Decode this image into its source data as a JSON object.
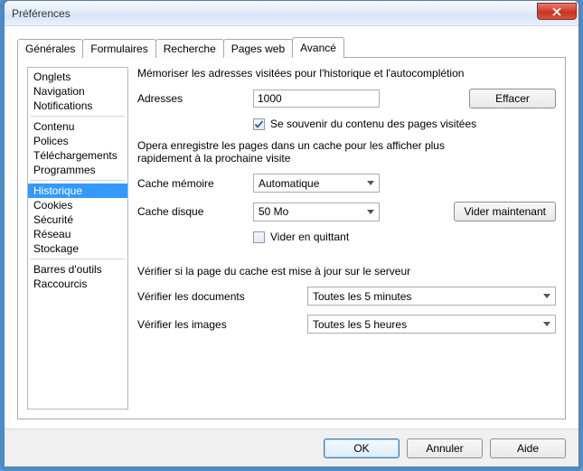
{
  "window": {
    "title": "Préférences"
  },
  "tabs": [
    {
      "label": "Générales"
    },
    {
      "label": "Formulaires"
    },
    {
      "label": "Recherche"
    },
    {
      "label": "Pages web"
    },
    {
      "label": "Avancé"
    }
  ],
  "sidebar": {
    "groups": [
      [
        "Onglets",
        "Navigation",
        "Notifications"
      ],
      [
        "Contenu",
        "Polices",
        "Téléchargements",
        "Programmes"
      ],
      [
        "Historique",
        "Cookies",
        "Sécurité",
        "Réseau",
        "Stockage"
      ],
      [
        "Barres d'outils",
        "Raccourcis"
      ]
    ],
    "selected": "Historique"
  },
  "history": {
    "intro": "Mémoriser les adresses visitées pour l'historique et l'autocomplétion",
    "addresses_label": "Adresses",
    "addresses_value": "1000",
    "clear_label": "Effacer",
    "remember_content_checked": true,
    "remember_content_label": "Se souvenir du contenu des pages visitées",
    "cache_intro": "Opera enregistre les pages dans un cache pour les afficher plus rapidement à la prochaine visite",
    "mem_cache_label": "Cache mémoire",
    "mem_cache_value": "Automatique",
    "disk_cache_label": "Cache disque",
    "disk_cache_value": "50 Mo",
    "empty_now_label": "Vider maintenant",
    "empty_on_exit_checked": false,
    "empty_on_exit_label": "Vider en quittant",
    "check_intro": "Vérifier si la page du cache est mise à jour sur le serveur",
    "check_docs_label": "Vérifier les documents",
    "check_docs_value": "Toutes les 5 minutes",
    "check_images_label": "Vérifier les images",
    "check_images_value": "Toutes les 5 heures"
  },
  "footer": {
    "ok": "OK",
    "cancel": "Annuler",
    "help": "Aide"
  }
}
